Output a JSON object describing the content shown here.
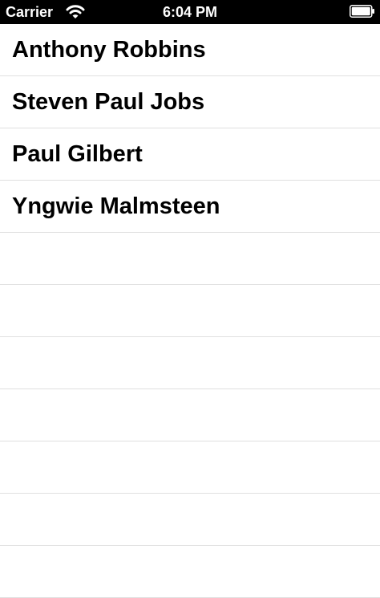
{
  "status_bar": {
    "carrier": "Carrier",
    "time": "6:04 PM",
    "wifi_icon": "wifi-icon",
    "battery_icon": "battery-icon",
    "battery_level": 1.0
  },
  "list": {
    "items": [
      {
        "label": "Anthony Robbins"
      },
      {
        "label": "Steven Paul Jobs"
      },
      {
        "label": "Paul Gilbert"
      },
      {
        "label": "Yngwie Malmsteen"
      },
      {
        "label": ""
      },
      {
        "label": ""
      },
      {
        "label": ""
      },
      {
        "label": ""
      },
      {
        "label": ""
      },
      {
        "label": ""
      },
      {
        "label": ""
      }
    ]
  }
}
